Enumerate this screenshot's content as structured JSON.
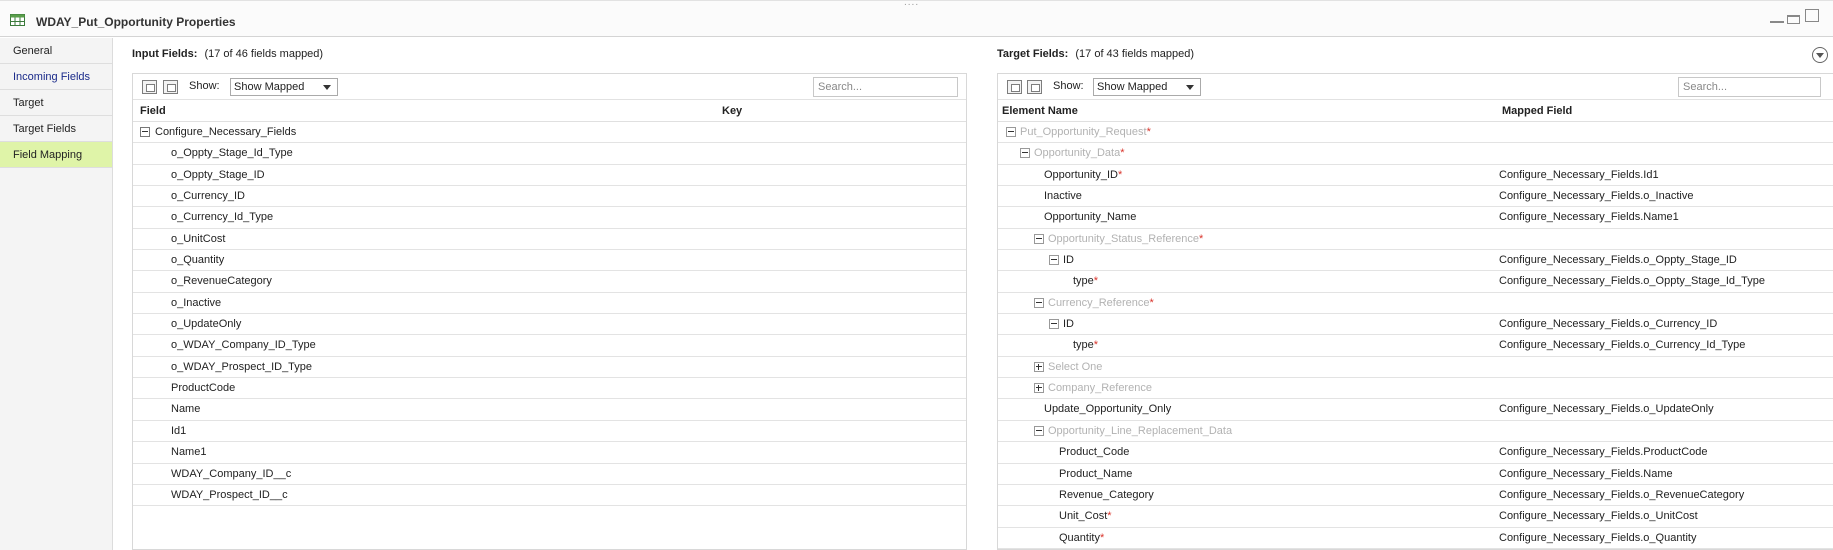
{
  "window": {
    "title": "WDAY_Put_Opportunity Properties",
    "icon": "table-properties-icon"
  },
  "sidebar": {
    "items": [
      {
        "label": "General",
        "state": "normal"
      },
      {
        "label": "Incoming Fields",
        "state": "link"
      },
      {
        "label": "Target",
        "state": "normal"
      },
      {
        "label": "Target Fields",
        "state": "normal"
      },
      {
        "label": "Field Mapping",
        "state": "active"
      }
    ]
  },
  "input_panel": {
    "label": "Input Fields:",
    "count": "(17 of 46 fields mapped)",
    "show_label": "Show:",
    "show_value": "Show Mapped",
    "search_placeholder": "Search...",
    "columns": {
      "field": "Field",
      "key": "Key"
    },
    "group": "Configure_Necessary_Fields",
    "rows": [
      "o_Oppty_Stage_Id_Type",
      "o_Oppty_Stage_ID",
      "o_Currency_ID",
      "o_Currency_Id_Type",
      "o_UnitCost",
      "o_Quantity",
      "o_RevenueCategory",
      "o_Inactive",
      "o_UpdateOnly",
      "o_WDAY_Company_ID_Type",
      "o_WDAY_Prospect_ID_Type",
      "ProductCode",
      "Name",
      "Id1",
      "Name1",
      "WDAY_Company_ID__c",
      "WDAY_Prospect_ID__c"
    ]
  },
  "target_panel": {
    "label": "Target Fields:",
    "count": "(17 of 43 fields mapped)",
    "show_label": "Show:",
    "show_value": "Show Mapped",
    "search_placeholder": "Search...",
    "columns": {
      "element": "Element Name",
      "mapped": "Mapped Field"
    },
    "rows": [
      {
        "name": "Put_Opportunity_Request",
        "required": true,
        "muted": true,
        "level": 0,
        "toggle": "minus",
        "mapped": ""
      },
      {
        "name": "Opportunity_Data",
        "required": true,
        "muted": true,
        "level": 1,
        "toggle": "minus",
        "mapped": ""
      },
      {
        "name": "Opportunity_ID",
        "required": true,
        "muted": false,
        "level": 2,
        "toggle": "",
        "mapped": "Configure_Necessary_Fields.Id1"
      },
      {
        "name": "Inactive",
        "required": false,
        "muted": false,
        "level": 2,
        "toggle": "",
        "mapped": "Configure_Necessary_Fields.o_Inactive"
      },
      {
        "name": "Opportunity_Name",
        "required": false,
        "muted": false,
        "level": 2,
        "toggle": "",
        "mapped": "Configure_Necessary_Fields.Name1"
      },
      {
        "name": "Opportunity_Status_Reference",
        "required": true,
        "muted": true,
        "level": 2,
        "toggle": "minus",
        "mapped": ""
      },
      {
        "name": "ID",
        "required": false,
        "muted": false,
        "level": 3,
        "toggle": "minus",
        "mapped": "Configure_Necessary_Fields.o_Oppty_Stage_ID"
      },
      {
        "name": "type",
        "required": true,
        "muted": false,
        "level": 4,
        "toggle": "",
        "mapped": "Configure_Necessary_Fields.o_Oppty_Stage_Id_Type"
      },
      {
        "name": "Currency_Reference",
        "required": true,
        "muted": true,
        "level": 2,
        "toggle": "minus",
        "mapped": ""
      },
      {
        "name": "ID",
        "required": false,
        "muted": false,
        "level": 3,
        "toggle": "minus",
        "mapped": "Configure_Necessary_Fields.o_Currency_ID"
      },
      {
        "name": "type",
        "required": true,
        "muted": false,
        "level": 4,
        "toggle": "",
        "mapped": "Configure_Necessary_Fields.o_Currency_Id_Type"
      },
      {
        "name": "Select One",
        "required": false,
        "muted": true,
        "level": 2,
        "toggle": "plus",
        "mapped": ""
      },
      {
        "name": "Company_Reference",
        "required": false,
        "muted": true,
        "level": 2,
        "toggle": "plus",
        "mapped": ""
      },
      {
        "name": "Update_Opportunity_Only",
        "required": false,
        "muted": false,
        "level": 2,
        "toggle": "",
        "mapped": "Configure_Necessary_Fields.o_UpdateOnly"
      },
      {
        "name": "Opportunity_Line_Replacement_Data",
        "required": false,
        "muted": true,
        "level": 2,
        "toggle": "minus",
        "mapped": ""
      },
      {
        "name": "Product_Code",
        "required": false,
        "muted": false,
        "level": 3,
        "toggle": "",
        "mapped": "Configure_Necessary_Fields.ProductCode"
      },
      {
        "name": "Product_Name",
        "required": false,
        "muted": false,
        "level": 3,
        "toggle": "",
        "mapped": "Configure_Necessary_Fields.Name"
      },
      {
        "name": "Revenue_Category",
        "required": false,
        "muted": false,
        "level": 3,
        "toggle": "",
        "mapped": "Configure_Necessary_Fields.o_RevenueCategory"
      },
      {
        "name": "Unit_Cost",
        "required": true,
        "muted": false,
        "level": 3,
        "toggle": "",
        "mapped": "Configure_Necessary_Fields.o_UnitCost"
      },
      {
        "name": "Quantity",
        "required": true,
        "muted": false,
        "level": 3,
        "toggle": "",
        "mapped": "Configure_Necessary_Fields.o_Quantity"
      }
    ]
  }
}
